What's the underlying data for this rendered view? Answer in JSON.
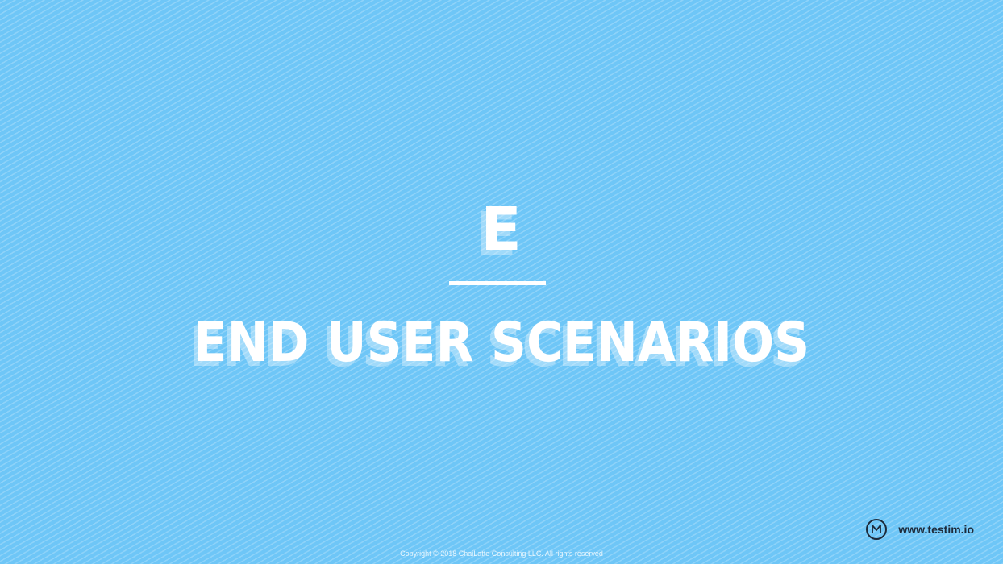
{
  "slide": {
    "section_letter": "E",
    "title": "END USER SCENARIOS",
    "copyright": "Copyright © 2018 ChaiLatte Consulting LLC. All rights reserved",
    "brand": {
      "logo_icon": "testim-logo-icon",
      "url": "www.testim.io"
    }
  },
  "colors": {
    "background": "#6ec6f7",
    "text": "#ffffff",
    "brand_text": "#1d2a3a"
  }
}
